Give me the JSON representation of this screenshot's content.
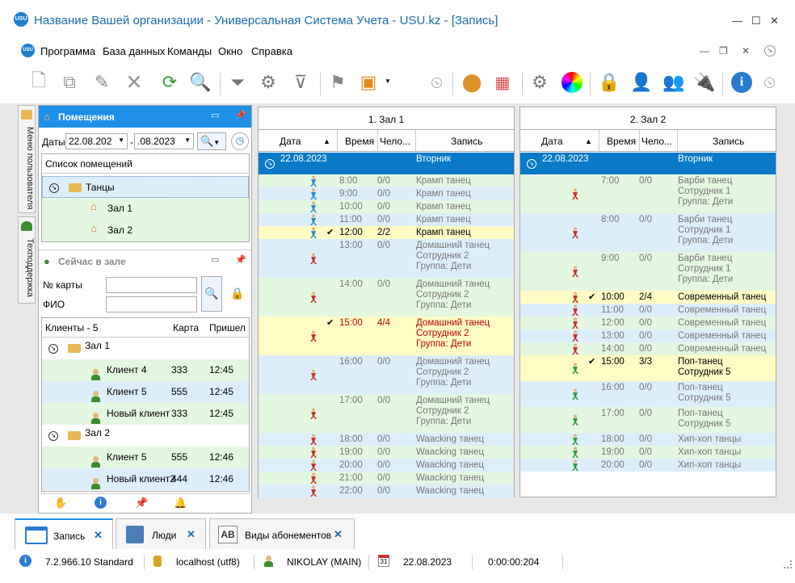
{
  "app": {
    "title": "Название Вашей организации - Универсальная Система Учета - USU.kz - [Запись]",
    "logo": "USU"
  },
  "menu": [
    "Программа",
    "База данных",
    "Команды",
    "Окно",
    "Справка"
  ],
  "sidetabs": [
    "Меню пользователя",
    "Техподдержка"
  ],
  "rooms": {
    "title": "Помещения",
    "dates_label": "Даты",
    "date_from": "22.08.202",
    "date_to": ".08.2023",
    "list_header": "Список помещений",
    "group": "Танцы",
    "items": [
      "Зал 1",
      "Зал 2"
    ]
  },
  "now": {
    "title": "Сейчас в зале",
    "card_label": "№ карты",
    "name_label": "ФИО",
    "cols": [
      "Клиенты - 5",
      "Карта",
      "Пришел"
    ],
    "groups": [
      {
        "name": "Зал 1",
        "clients": [
          {
            "name": "Клиент 4",
            "card": "333",
            "time": "12:45"
          },
          {
            "name": "Клиент 5",
            "card": "555",
            "time": "12:45"
          },
          {
            "name": "Новый клиент",
            "card": "333",
            "time": "12:45"
          }
        ]
      },
      {
        "name": "Зал 2",
        "clients": [
          {
            "name": "Клиент 5",
            "card": "555",
            "time": "12:46"
          },
          {
            "name": "Новый клиент2",
            "card": "444",
            "time": "12:46"
          }
        ]
      }
    ]
  },
  "cols": {
    "date": "Дата",
    "time": "Время",
    "people": "Чело...",
    "record": "Запись"
  },
  "hall1": {
    "title": "1. Зал 1",
    "date": "22.08.2023",
    "weekday": "Вторник",
    "rows": [
      {
        "time": "8:00",
        "cnt": "0/0",
        "lines": [
          "Крамп танец"
        ],
        "h": 16,
        "style": "g"
      },
      {
        "time": "9:00",
        "cnt": "0/0",
        "lines": [
          "Крамп танец"
        ],
        "h": 16,
        "style": "b"
      },
      {
        "time": "10:00",
        "cnt": "0/0",
        "lines": [
          "Крамп танец"
        ],
        "h": 16,
        "style": "g"
      },
      {
        "time": "11:00",
        "cnt": "0/0",
        "lines": [
          "Крамп танец"
        ],
        "h": 16,
        "style": "b"
      },
      {
        "time": "12:00",
        "cnt": "2/2",
        "lines": [
          "Крамп танец"
        ],
        "h": 16,
        "style": "y",
        "check": true
      },
      {
        "time": "13:00",
        "cnt": "0/0",
        "lines": [
          "Домашний танец",
          "Сотрудник 2",
          "Группа: Дети"
        ],
        "h": 48,
        "style": "b"
      },
      {
        "time": "14:00",
        "cnt": "0/0",
        "lines": [
          "Домашний танец",
          "Сотрудник 2",
          "Группа: Дети"
        ],
        "h": 48,
        "style": "g"
      },
      {
        "time": "15:00",
        "cnt": "4/4",
        "lines": [
          "Домашний танец",
          "Сотрудник 2",
          "Группа: Дети"
        ],
        "h": 48,
        "style": "yr",
        "check": true
      },
      {
        "time": "16:00",
        "cnt": "0/0",
        "lines": [
          "Домашний танец",
          "Сотрудник 2",
          "Группа: Дети"
        ],
        "h": 48,
        "style": "b"
      },
      {
        "time": "17:00",
        "cnt": "0/0",
        "lines": [
          "Домашний танец",
          "Сотрудник 2",
          "Группа: Дети"
        ],
        "h": 48,
        "style": "g"
      },
      {
        "time": "18:00",
        "cnt": "0/0",
        "lines": [
          "Waacking танец"
        ],
        "h": 16,
        "style": "b"
      },
      {
        "time": "19:00",
        "cnt": "0/0",
        "lines": [
          "Waacking танец"
        ],
        "h": 16,
        "style": "g"
      },
      {
        "time": "20:00",
        "cnt": "0/0",
        "lines": [
          "Waacking танец"
        ],
        "h": 16,
        "style": "b"
      },
      {
        "time": "21:00",
        "cnt": "0/0",
        "lines": [
          "Waacking танец"
        ],
        "h": 16,
        "style": "g"
      },
      {
        "time": "22:00",
        "cnt": "0/0",
        "lines": [
          "Waacking танец"
        ],
        "h": 16,
        "style": "b"
      }
    ]
  },
  "hall2": {
    "title": "2. Зал 2",
    "date": "22.08.2023",
    "weekday": "Вторник",
    "rows": [
      {
        "time": "7:00",
        "cnt": "0/0",
        "lines": [
          "Барби танец",
          "Сотрудник 1",
          "Группа: Дети"
        ],
        "h": 48,
        "style": "g"
      },
      {
        "time": "8:00",
        "cnt": "0/0",
        "lines": [
          "Барби танец",
          "Сотрудник 1",
          "Группа: Дети"
        ],
        "h": 48,
        "style": "b"
      },
      {
        "time": "9:00",
        "cnt": "0/0",
        "lines": [
          "Барби танец",
          "Сотрудник 1",
          "Группа: Дети"
        ],
        "h": 48,
        "style": "g"
      },
      {
        "time": "10:00",
        "cnt": "2/4",
        "lines": [
          "Современный танец"
        ],
        "h": 16,
        "style": "y",
        "check": true
      },
      {
        "time": "11:00",
        "cnt": "0/0",
        "lines": [
          "Современный танец"
        ],
        "h": 16,
        "style": "b"
      },
      {
        "time": "12:00",
        "cnt": "0/0",
        "lines": [
          "Современный танец"
        ],
        "h": 16,
        "style": "g"
      },
      {
        "time": "13:00",
        "cnt": "0/0",
        "lines": [
          "Современный танец"
        ],
        "h": 16,
        "style": "b"
      },
      {
        "time": "14:00",
        "cnt": "0/0",
        "lines": [
          "Современный танец"
        ],
        "h": 16,
        "style": "g"
      },
      {
        "time": "15:00",
        "cnt": "3/3",
        "lines": [
          "Поп-танец",
          "Сотрудник 5"
        ],
        "h": 32,
        "style": "y",
        "check": true
      },
      {
        "time": "16:00",
        "cnt": "0/0",
        "lines": [
          "Поп-танец",
          "Сотрудник 5"
        ],
        "h": 32,
        "style": "b"
      },
      {
        "time": "17:00",
        "cnt": "0/0",
        "lines": [
          "Поп-танец",
          "Сотрудник 5"
        ],
        "h": 32,
        "style": "g"
      },
      {
        "time": "18:00",
        "cnt": "0/0",
        "lines": [
          "Хип-хоп танцы"
        ],
        "h": 16,
        "style": "b"
      },
      {
        "time": "19:00",
        "cnt": "0/0",
        "lines": [
          "Хип-хоп танцы"
        ],
        "h": 16,
        "style": "g"
      },
      {
        "time": "20:00",
        "cnt": "0/0",
        "lines": [
          "Хип-хоп танцы"
        ],
        "h": 16,
        "style": "b"
      }
    ]
  },
  "tabs": [
    "Запись",
    "Люди",
    "Виды абонементов"
  ],
  "status": {
    "version": "7.2.966.10 Standard",
    "db": "localhost (utf8)",
    "user": "NIKOLAY (MAIN)",
    "date": "22.08.2023",
    "timer": "0:00:00:204",
    "cal_day": "31"
  },
  "colors": {
    "accent": "#1e90e8",
    "date_row": "#0a79c8",
    "green": "#e4f7e0",
    "blue": "#dceefa",
    "yellow": "#fffcc4",
    "red": "#c00000"
  }
}
